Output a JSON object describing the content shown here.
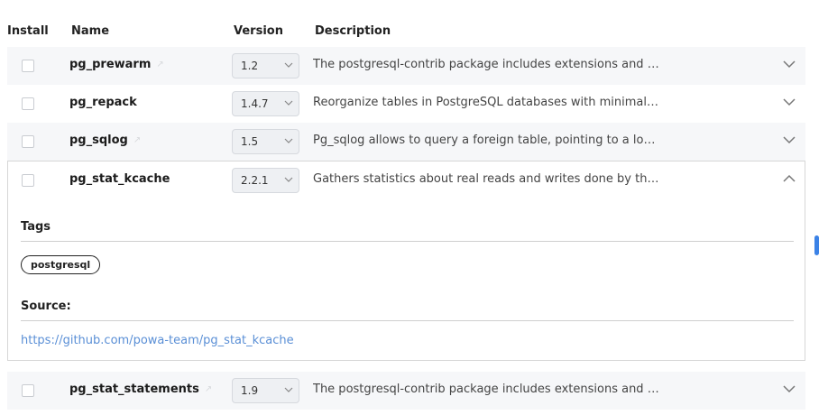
{
  "columns": {
    "install": "Install",
    "name": "Name",
    "version": "Version",
    "description": "Description"
  },
  "rows_top": [
    {
      "name": "pg_prewarm",
      "external": true,
      "version": "1.2",
      "description": "The postgresql-contrib package includes extensions and additional utilities"
    },
    {
      "name": "pg_repack",
      "external": false,
      "version": "1.4.7",
      "description": "Reorganize tables in PostgreSQL databases with minimal locks"
    },
    {
      "name": "pg_sqlog",
      "external": true,
      "version": "1.5",
      "description": "Pg_sqlog allows to query a foreign table, pointing to a log, recorded in a CSV format"
    }
  ],
  "expanded": {
    "name": "pg_stat_kcache",
    "version": "2.2.1",
    "description": "Gathers statistics about real reads and writes done by the filesystem layer",
    "tags_label": "Tags",
    "tags": [
      "postgresql"
    ],
    "source_label": "Source:",
    "source_url": "https://github.com/powa-team/pg_stat_kcache"
  },
  "rows_bottom": [
    {
      "name": "pg_stat_statements",
      "external": true,
      "version": "1.9",
      "description": "The postgresql-contrib package includes extensions and additional utilities"
    }
  ],
  "icons": {
    "external_link": "external-link-icon",
    "chevron_down": "chevron-down-icon",
    "chevron_up": "chevron-up-icon"
  },
  "colors": {
    "link": "#5a8fd6",
    "scrollbar": "#3b82e6",
    "row_alt": "#f6f7f9"
  }
}
